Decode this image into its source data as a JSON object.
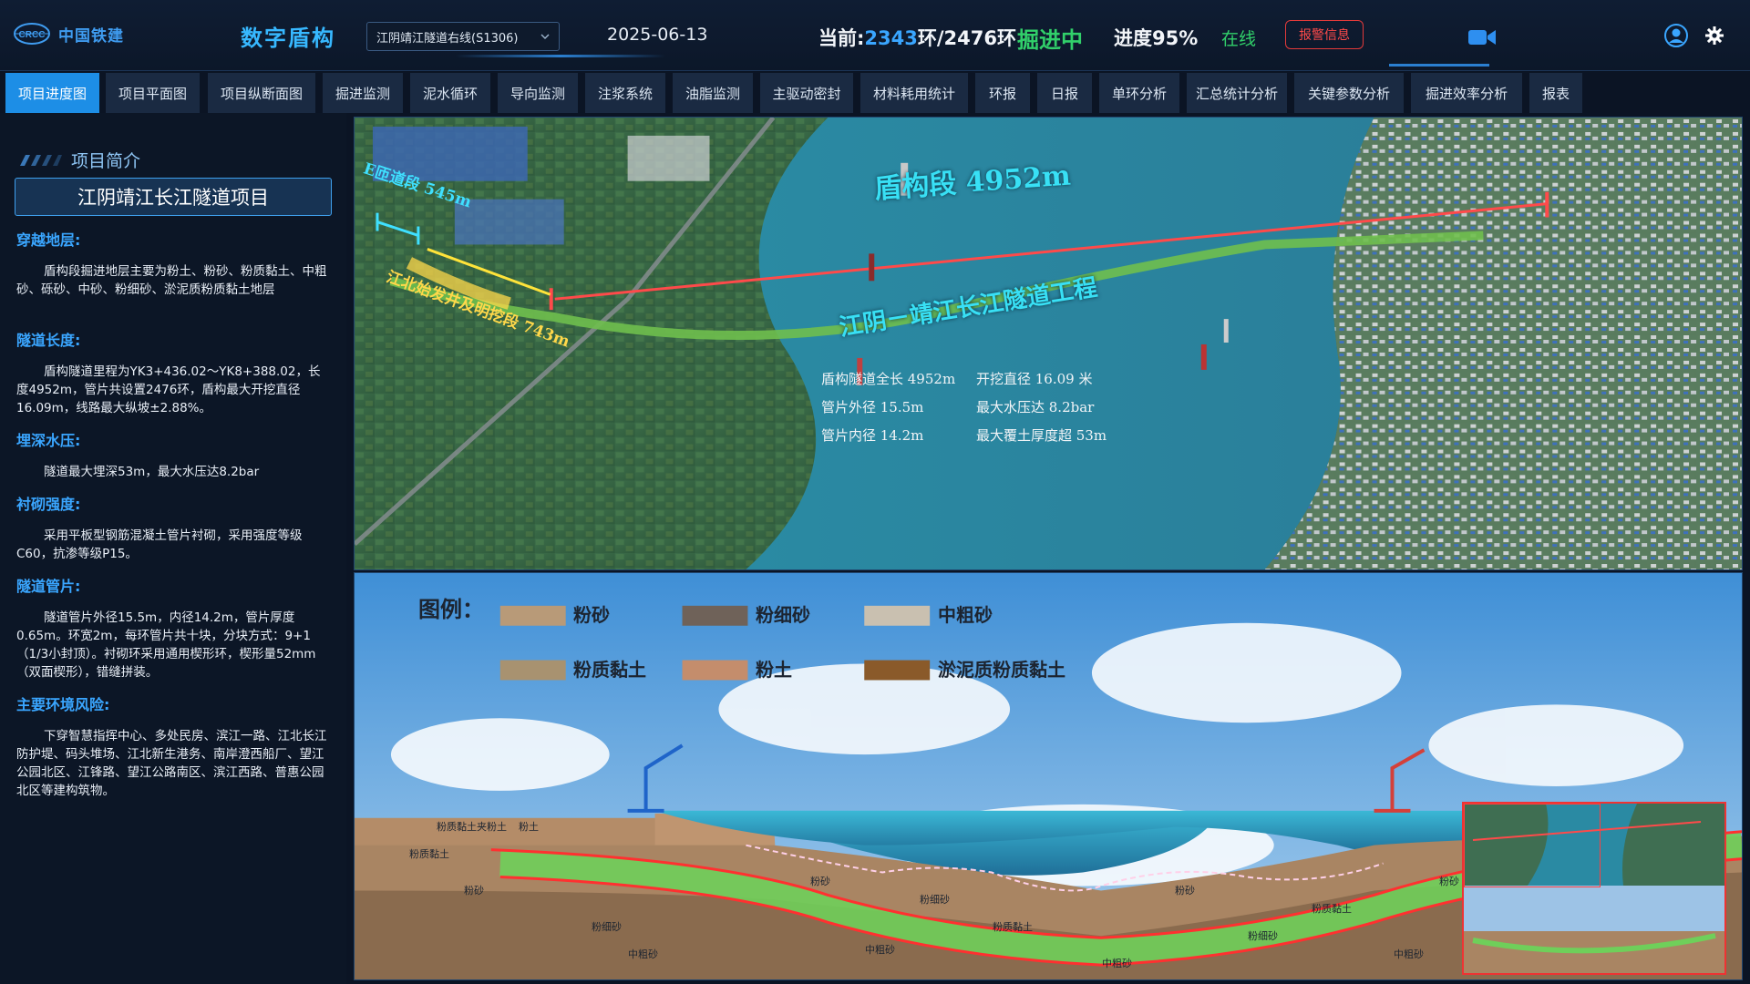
{
  "header": {
    "logo_text": "中国铁建",
    "app_title": "数字盾构",
    "line_select": "江阴靖江隧道右线(S1306)",
    "date": "2025-06-13",
    "ring_prefix": "当前:",
    "ring_current": "2343",
    "ring_suffix": "环/2476环",
    "status": "掘进中",
    "progress": "进度95%",
    "online": "在线",
    "alarm": "报警信息",
    "colors": {
      "accent": "#37b8ff",
      "ok": "#31d06a",
      "alarm": "#e23a3a"
    },
    "icons": [
      "camera-icon",
      "user-icon",
      "gear-icon"
    ]
  },
  "tabs": [
    {
      "label": "项目进度图",
      "active": true
    },
    {
      "label": "项目平面图"
    },
    {
      "label": "项目纵断面图"
    },
    {
      "label": "掘进监测"
    },
    {
      "label": "泥水循环"
    },
    {
      "label": "导向监测"
    },
    {
      "label": "注浆系统"
    },
    {
      "label": "油脂监测"
    },
    {
      "label": "主驱动密封"
    },
    {
      "label": "材料耗用统计"
    },
    {
      "label": "环报"
    },
    {
      "label": "日报"
    },
    {
      "label": "单环分析"
    },
    {
      "label": "汇总统计分析"
    },
    {
      "label": "关键参数分析"
    },
    {
      "label": "掘进效率分析"
    },
    {
      "label": "报表"
    }
  ],
  "left": {
    "intro_label": "项目简介",
    "project_name": "江阴靖江长江隧道项目",
    "sections": [
      {
        "title": "穿越地层:",
        "body": "盾构段掘进地层主要为粉土、粉砂、粉质黏土、中粗砂、砾砂、中砂、粉细砂、淤泥质粉质黏土地层"
      },
      {
        "title": "隧道长度:",
        "body": "盾构隧道里程为YK3+436.02～YK8+388.02，长度4952m，管片共设置2476环，盾构最大开挖直径16.09m，线路最大纵坡±2.88%。"
      },
      {
        "title": "埋深水压:",
        "body": "隧道最大埋深53m，最大水压达8.2bar"
      },
      {
        "title": "衬砌强度:",
        "body": "采用平板型钢筋混凝土管片衬砌，采用强度等级C60，抗渗等级P15。"
      },
      {
        "title": "隧道管片:",
        "body": "隧道管片外径15.5m，内径14.2m，管片厚度0.65m。环宽2m，每环管片共十块，分块方式：9+1（1/3小封顶）。衬砌环采用通用楔形环，楔形量52mm（双面楔形），错缝拼装。"
      },
      {
        "title": "主要环境风险:",
        "body": "下穿智慧指挥中心、多处民房、滨江一路、江北长江防护堤、码头堆场、江北新生港务、南岸澄西船厂、望江公园北区、江锋路、望江公路南区、滨江西路、普惠公园北区等建构筑物。"
      }
    ]
  },
  "map": {
    "shield_label": "盾构段 4952m",
    "project_label": "江阴－靖江长江隧道工程",
    "e_ramp": "E匝道段 545m",
    "north_shaft": "江北始发井及明挖段 743m",
    "specs": [
      "盾构隧道全长 4952m",
      "开挖直径 16.09 米",
      "管片外径 15.5m",
      "最大水压达 8.2bar",
      "管片内径 14.2m",
      "最大覆土厚度超 53m"
    ]
  },
  "profile": {
    "legend_title": "图例：",
    "legend": [
      {
        "name": "粉砂",
        "color": "#b89a78"
      },
      {
        "name": "粉细砂",
        "color": "#6f6259"
      },
      {
        "name": "中粗砂",
        "color": "#c9c0b0"
      },
      {
        "name": "粉质黏土",
        "color": "#a89270"
      },
      {
        "name": "粉土",
        "color": "#c48d6c"
      },
      {
        "name": "淤泥质粉质黏土",
        "color": "#8a5a2a"
      }
    ],
    "labels": [
      "粉质黏土",
      "粉砂",
      "粉细砂",
      "中粗砂",
      "粉土",
      "中粗砂",
      "粉质黏土夹粉土",
      "粉砂",
      "粉细砂",
      "粉质黏土",
      "中粗砂",
      "粉砂",
      "粉细砂",
      "粉质黏土",
      "中粗砂",
      "粉砂"
    ]
  }
}
